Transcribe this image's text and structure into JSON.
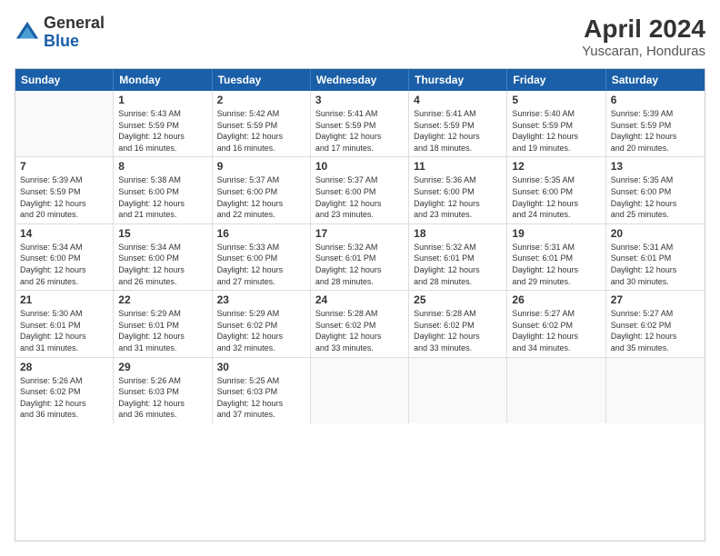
{
  "logo": {
    "line1": "General",
    "line2": "Blue"
  },
  "title": "April 2024",
  "subtitle": "Yuscaran, Honduras",
  "days": [
    "Sunday",
    "Monday",
    "Tuesday",
    "Wednesday",
    "Thursday",
    "Friday",
    "Saturday"
  ],
  "weeks": [
    [
      {
        "day": "",
        "info": ""
      },
      {
        "day": "1",
        "info": "Sunrise: 5:43 AM\nSunset: 5:59 PM\nDaylight: 12 hours\nand 16 minutes."
      },
      {
        "day": "2",
        "info": "Sunrise: 5:42 AM\nSunset: 5:59 PM\nDaylight: 12 hours\nand 16 minutes."
      },
      {
        "day": "3",
        "info": "Sunrise: 5:41 AM\nSunset: 5:59 PM\nDaylight: 12 hours\nand 17 minutes."
      },
      {
        "day": "4",
        "info": "Sunrise: 5:41 AM\nSunset: 5:59 PM\nDaylight: 12 hours\nand 18 minutes."
      },
      {
        "day": "5",
        "info": "Sunrise: 5:40 AM\nSunset: 5:59 PM\nDaylight: 12 hours\nand 19 minutes."
      },
      {
        "day": "6",
        "info": "Sunrise: 5:39 AM\nSunset: 5:59 PM\nDaylight: 12 hours\nand 20 minutes."
      }
    ],
    [
      {
        "day": "7",
        "info": "Sunrise: 5:39 AM\nSunset: 5:59 PM\nDaylight: 12 hours\nand 20 minutes."
      },
      {
        "day": "8",
        "info": "Sunrise: 5:38 AM\nSunset: 6:00 PM\nDaylight: 12 hours\nand 21 minutes."
      },
      {
        "day": "9",
        "info": "Sunrise: 5:37 AM\nSunset: 6:00 PM\nDaylight: 12 hours\nand 22 minutes."
      },
      {
        "day": "10",
        "info": "Sunrise: 5:37 AM\nSunset: 6:00 PM\nDaylight: 12 hours\nand 23 minutes."
      },
      {
        "day": "11",
        "info": "Sunrise: 5:36 AM\nSunset: 6:00 PM\nDaylight: 12 hours\nand 23 minutes."
      },
      {
        "day": "12",
        "info": "Sunrise: 5:35 AM\nSunset: 6:00 PM\nDaylight: 12 hours\nand 24 minutes."
      },
      {
        "day": "13",
        "info": "Sunrise: 5:35 AM\nSunset: 6:00 PM\nDaylight: 12 hours\nand 25 minutes."
      }
    ],
    [
      {
        "day": "14",
        "info": "Sunrise: 5:34 AM\nSunset: 6:00 PM\nDaylight: 12 hours\nand 26 minutes."
      },
      {
        "day": "15",
        "info": "Sunrise: 5:34 AM\nSunset: 6:00 PM\nDaylight: 12 hours\nand 26 minutes."
      },
      {
        "day": "16",
        "info": "Sunrise: 5:33 AM\nSunset: 6:00 PM\nDaylight: 12 hours\nand 27 minutes."
      },
      {
        "day": "17",
        "info": "Sunrise: 5:32 AM\nSunset: 6:01 PM\nDaylight: 12 hours\nand 28 minutes."
      },
      {
        "day": "18",
        "info": "Sunrise: 5:32 AM\nSunset: 6:01 PM\nDaylight: 12 hours\nand 28 minutes."
      },
      {
        "day": "19",
        "info": "Sunrise: 5:31 AM\nSunset: 6:01 PM\nDaylight: 12 hours\nand 29 minutes."
      },
      {
        "day": "20",
        "info": "Sunrise: 5:31 AM\nSunset: 6:01 PM\nDaylight: 12 hours\nand 30 minutes."
      }
    ],
    [
      {
        "day": "21",
        "info": "Sunrise: 5:30 AM\nSunset: 6:01 PM\nDaylight: 12 hours\nand 31 minutes."
      },
      {
        "day": "22",
        "info": "Sunrise: 5:29 AM\nSunset: 6:01 PM\nDaylight: 12 hours\nand 31 minutes."
      },
      {
        "day": "23",
        "info": "Sunrise: 5:29 AM\nSunset: 6:02 PM\nDaylight: 12 hours\nand 32 minutes."
      },
      {
        "day": "24",
        "info": "Sunrise: 5:28 AM\nSunset: 6:02 PM\nDaylight: 12 hours\nand 33 minutes."
      },
      {
        "day": "25",
        "info": "Sunrise: 5:28 AM\nSunset: 6:02 PM\nDaylight: 12 hours\nand 33 minutes."
      },
      {
        "day": "26",
        "info": "Sunrise: 5:27 AM\nSunset: 6:02 PM\nDaylight: 12 hours\nand 34 minutes."
      },
      {
        "day": "27",
        "info": "Sunrise: 5:27 AM\nSunset: 6:02 PM\nDaylight: 12 hours\nand 35 minutes."
      }
    ],
    [
      {
        "day": "28",
        "info": "Sunrise: 5:26 AM\nSunset: 6:02 PM\nDaylight: 12 hours\nand 36 minutes."
      },
      {
        "day": "29",
        "info": "Sunrise: 5:26 AM\nSunset: 6:03 PM\nDaylight: 12 hours\nand 36 minutes."
      },
      {
        "day": "30",
        "info": "Sunrise: 5:25 AM\nSunset: 6:03 PM\nDaylight: 12 hours\nand 37 minutes."
      },
      {
        "day": "",
        "info": ""
      },
      {
        "day": "",
        "info": ""
      },
      {
        "day": "",
        "info": ""
      },
      {
        "day": "",
        "info": ""
      }
    ]
  ]
}
